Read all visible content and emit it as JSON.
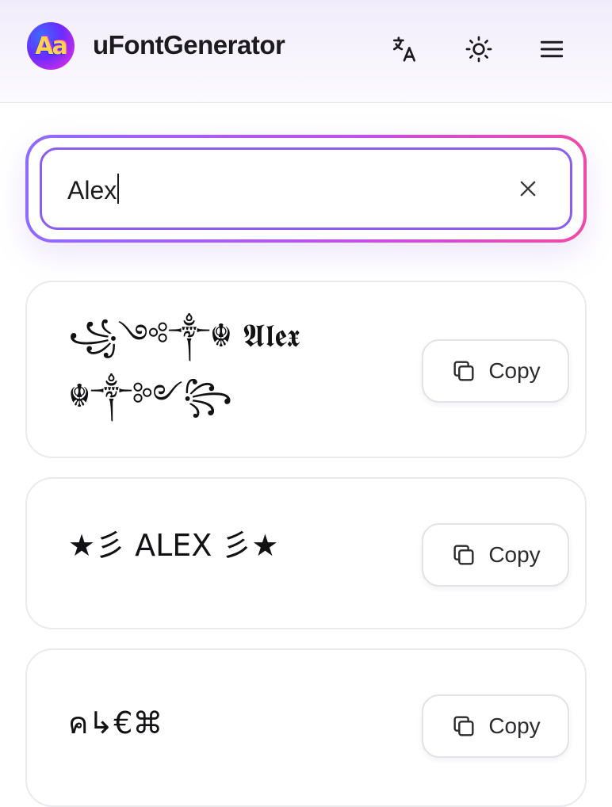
{
  "header": {
    "logo_text": "Aa",
    "app_title": "uFontGenerator",
    "icons": [
      "translate-icon",
      "sun-icon",
      "menu-icon"
    ]
  },
  "search": {
    "value": "Alex",
    "clear_icon": "close-icon"
  },
  "results": [
    {
      "text": "꧁༺༒☬ 𝕬𝖑𝖊𝖝\n☬༒༻꧂",
      "copy_label": "Copy",
      "copy_icon": "copy-icon"
    },
    {
      "text": "★彡 ALEX 彡★",
      "copy_label": "Copy",
      "copy_icon": "copy-icon"
    },
    {
      "text": "ค↳€⌘",
      "copy_label": "Copy",
      "copy_icon": "copy-icon"
    }
  ],
  "colors": {
    "accent_start": "#8e6bff",
    "accent_end": "#f14aa6",
    "field_border": "#8a5cf0"
  }
}
